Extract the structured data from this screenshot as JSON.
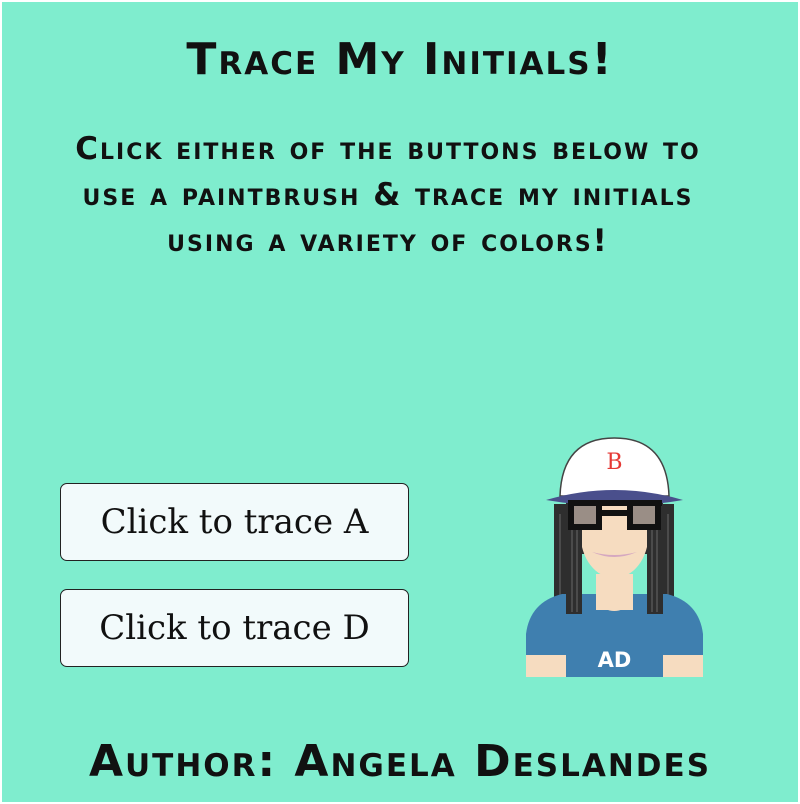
{
  "page": {
    "title": "Trace My Initials!",
    "instructions": "Click either of the buttons below to use a paintbrush & trace my initials using a variety of colors!",
    "author": "Author: Angela Deslandes"
  },
  "buttons": {
    "trace_a_label": "Click to trace A",
    "trace_d_label": "Click to trace D"
  },
  "avatar": {
    "cap_letter": "B",
    "shirt_text": "AD"
  },
  "colors": {
    "background": "#7FEDCE",
    "button_fill": "#F2FAFB",
    "cap_letter": "#E53935",
    "shirt": "#3F7FAF",
    "cap_brim": "#4A4F8C",
    "hair": "#2E2E2E",
    "skin": "#F6DCC0"
  }
}
